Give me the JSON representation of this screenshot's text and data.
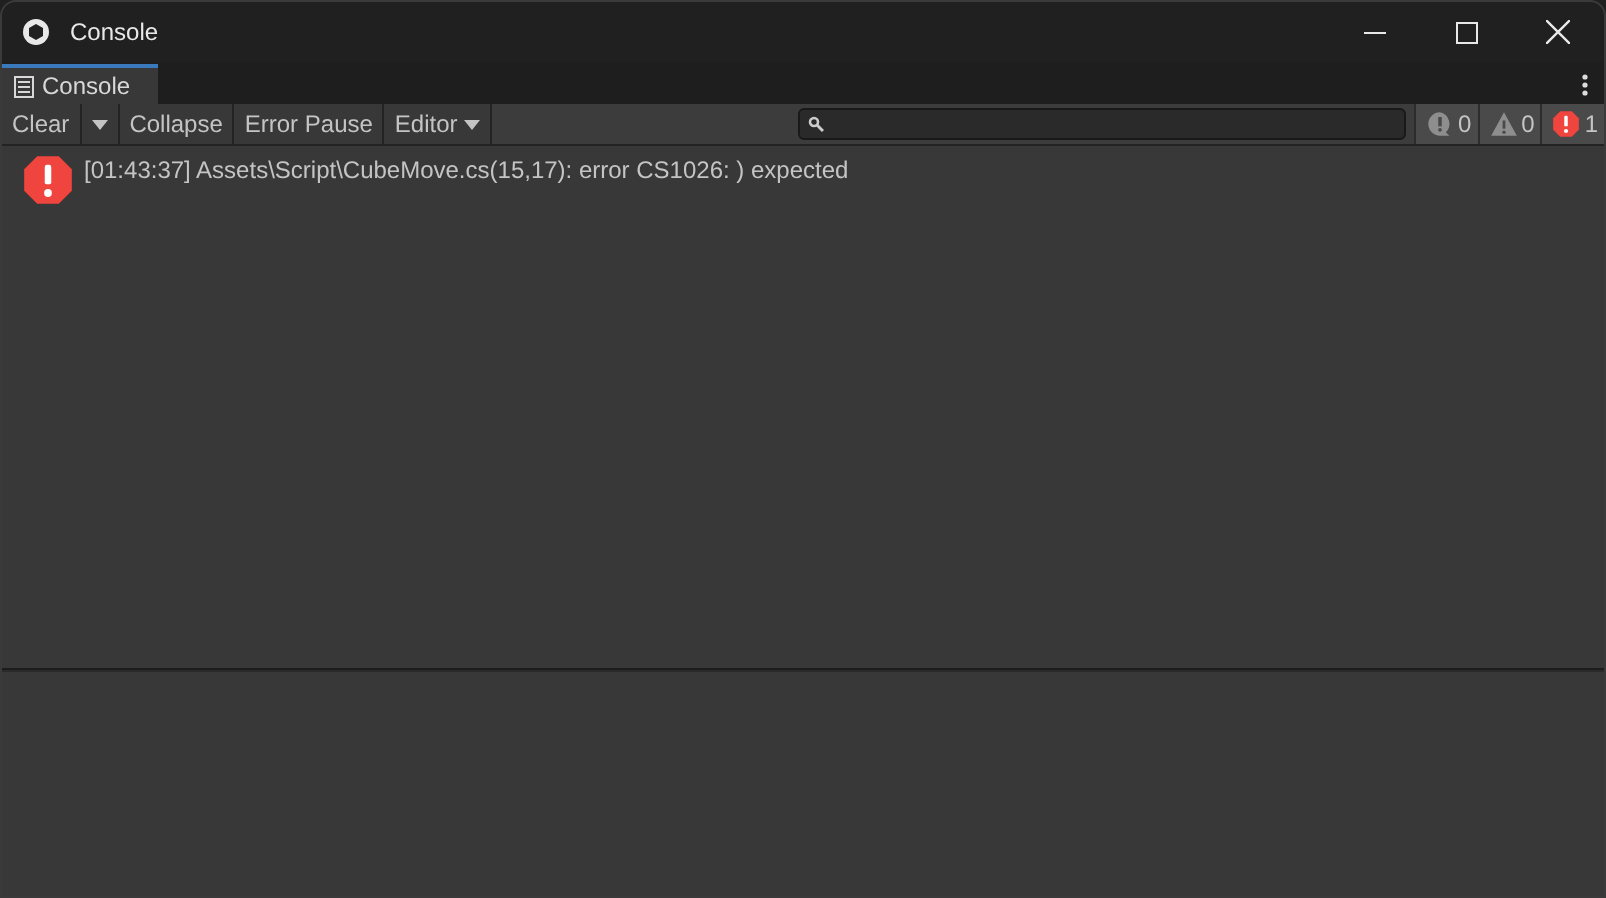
{
  "window": {
    "title": "Console"
  },
  "tabs": [
    {
      "label": "Console",
      "selected": true
    }
  ],
  "toolbar": {
    "buttons": [
      {
        "kind": "button",
        "label": "Clear"
      },
      {
        "kind": "dropdown"
      },
      {
        "kind": "button",
        "label": "Collapse"
      },
      {
        "kind": "button",
        "label": "Error Pause"
      },
      {
        "kind": "menu",
        "label": "Editor"
      }
    ],
    "counters": [
      {
        "kind": "info",
        "count": "0"
      },
      {
        "kind": "warning",
        "count": "0"
      },
      {
        "kind": "error",
        "count": "1"
      }
    ]
  },
  "log": [
    {
      "kind": "error",
      "message": "[01:43:37] Assets\\Script\\CubeMove.cs(15,17): error CS1026: ) expected"
    }
  ]
}
